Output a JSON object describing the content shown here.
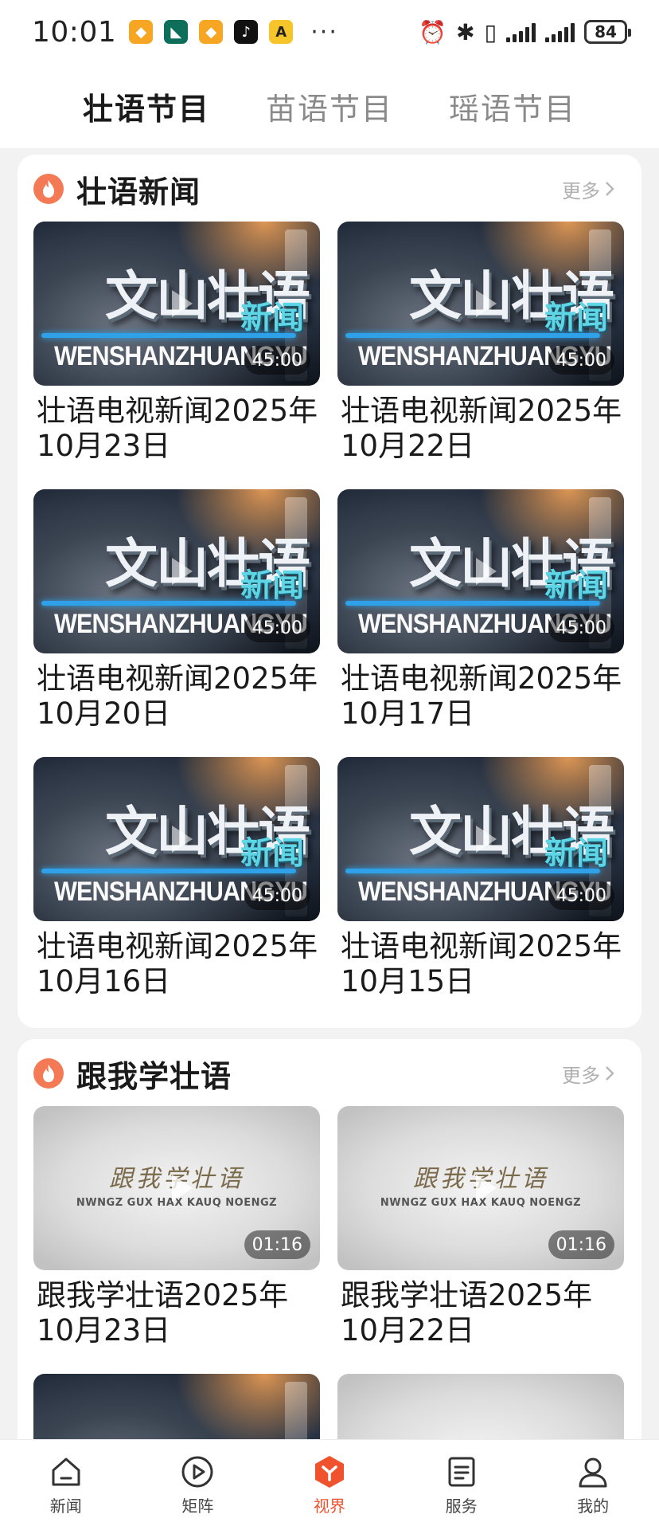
{
  "status_bar": {
    "time": "10:01",
    "more": "···",
    "battery": "84",
    "apps": [
      {
        "icon": "orange-app-icon",
        "color": "#f6a623"
      },
      {
        "icon": "green-app-icon",
        "color": "#0d6e5a"
      },
      {
        "icon": "orange-app-icon",
        "color": "#f6a623"
      },
      {
        "icon": "tiktok-icon",
        "color": "#111111"
      },
      {
        "icon": "yellow-app-icon",
        "color": "#f6c52a"
      }
    ]
  },
  "tabs": [
    {
      "label": "壮语节目",
      "active": true
    },
    {
      "label": "苗语节目",
      "active": false
    },
    {
      "label": "瑶语节目",
      "active": false
    }
  ],
  "sections": [
    {
      "title": "壮语新闻",
      "more": "更多",
      "videos": [
        {
          "title": "壮语电视新闻2025年10月23日",
          "duration": "45:00",
          "thumb_text": "文山壮语",
          "thumb_accent": "新闻",
          "thumb_caption": "WENSHANZHUANGYU"
        },
        {
          "title": "壮语电视新闻2025年10月22日",
          "duration": "45:00",
          "thumb_text": "文山壮语",
          "thumb_accent": "新闻",
          "thumb_caption": "WENSHANZHUANGYU"
        },
        {
          "title": "壮语电视新闻2025年10月20日",
          "duration": "45:00",
          "thumb_text": "文山壮语",
          "thumb_accent": "新闻",
          "thumb_caption": "WENSHANZHUANGYU"
        },
        {
          "title": "壮语电视新闻2025年10月17日",
          "duration": "45:00",
          "thumb_text": "文山壮语",
          "thumb_accent": "新闻",
          "thumb_caption": "WENSHANZHUANGYU"
        },
        {
          "title": "壮语电视新闻2025年10月16日",
          "duration": "45:00",
          "thumb_text": "文山壮语",
          "thumb_accent": "新闻",
          "thumb_caption": "WENSHANZHUANGYU"
        },
        {
          "title": "壮语电视新闻2025年10月15日",
          "duration": "45:00",
          "thumb_text": "文山壮语",
          "thumb_accent": "新闻",
          "thumb_caption": "WENSHANZHUANGYU"
        }
      ]
    },
    {
      "title": "跟我学壮语",
      "more": "更多",
      "videos": [
        {
          "title": "跟我学壮语2025年10月23日",
          "duration": "01:16",
          "thumb_text": "跟我学壮语",
          "thumb_caption": "NWNGZ GUX HAX KAUQ NOENGZ"
        },
        {
          "title": "跟我学壮语2025年10月22日",
          "duration": "01:16",
          "thumb_text": "跟我学壮语",
          "thumb_caption": "NWNGZ GUX HAX KAUQ NOENGZ"
        }
      ]
    }
  ],
  "bottom_nav": [
    {
      "label": "新闻",
      "icon": "home-icon",
      "active": false
    },
    {
      "label": "矩阵",
      "icon": "play-circle-icon",
      "active": false
    },
    {
      "label": "视界",
      "icon": "vision-icon",
      "active": true
    },
    {
      "label": "服务",
      "icon": "document-icon",
      "active": false
    },
    {
      "label": "我的",
      "icon": "user-icon",
      "active": false
    }
  ],
  "colors": {
    "accent": "#f0522e",
    "fire": "#f47a56"
  }
}
